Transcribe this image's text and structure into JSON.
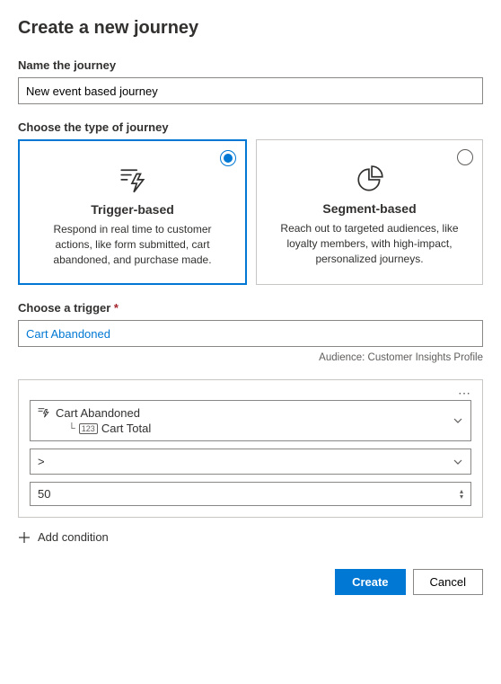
{
  "title": "Create a new journey",
  "name_section": {
    "label": "Name the journey",
    "value": "New event based journey"
  },
  "type_section": {
    "label": "Choose the type of journey",
    "options": [
      {
        "title": "Trigger-based",
        "desc": "Respond in real time to customer actions, like form submitted, cart abandoned, and purchase made.",
        "selected": true
      },
      {
        "title": "Segment-based",
        "desc": "Reach out to targeted audiences, like loyalty members, with high-impact, personalized journeys.",
        "selected": false
      }
    ]
  },
  "trigger_section": {
    "label": "Choose a trigger",
    "value": "Cart Abandoned",
    "audience_label": "Audience:",
    "audience_value": "Customer Insights Profile"
  },
  "condition": {
    "attribute_root": "Cart Abandoned",
    "attribute_child": "Cart Total",
    "operator": ">",
    "value": "50"
  },
  "add_condition_label": "Add condition",
  "footer": {
    "create": "Create",
    "cancel": "Cancel"
  }
}
